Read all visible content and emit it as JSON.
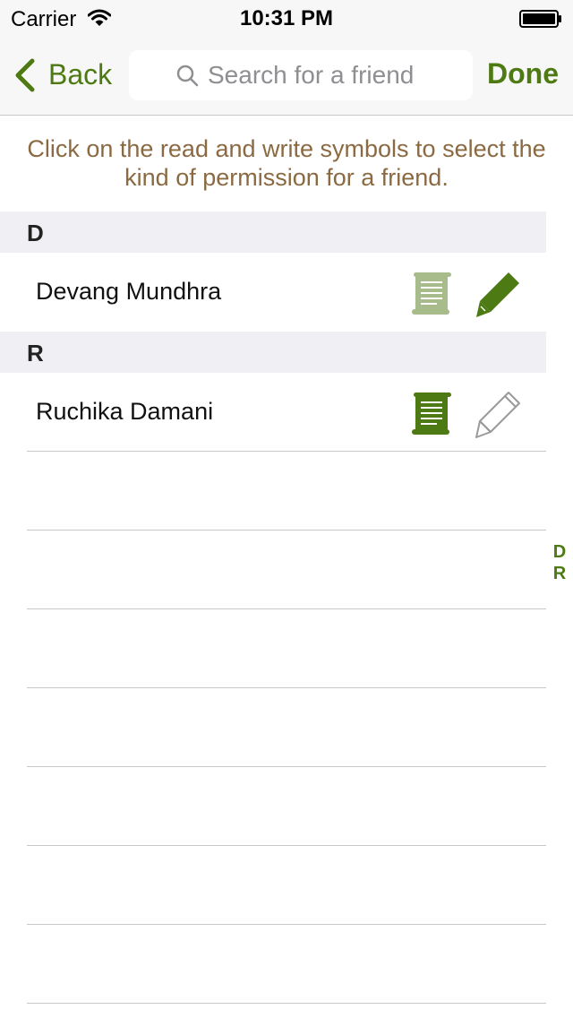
{
  "status_bar": {
    "carrier": "Carrier",
    "time": "10:31 PM",
    "icons": [
      "wifi-icon",
      "battery-icon"
    ]
  },
  "nav": {
    "back_label": "Back",
    "search_placeholder": "Search for a friend",
    "search_value": "",
    "done_label": "Done"
  },
  "instruction": "Click on the read and write symbols to select the kind of permission for a friend.",
  "sections": [
    {
      "letter": "D",
      "friends": [
        {
          "name": "Devang Mundhra",
          "read_permission": false,
          "write_permission": true
        }
      ]
    },
    {
      "letter": "R",
      "friends": [
        {
          "name": "Ruchika Damani",
          "read_permission": true,
          "write_permission": false
        }
      ]
    }
  ],
  "section_index": [
    "D",
    "R"
  ],
  "colors": {
    "accent": "#4d7a12",
    "instruction_text": "#8b6a42",
    "read_inactive": "#a8bb8a",
    "write_inactive": "#9a9a9a",
    "section_header_bg": "#efeff4"
  }
}
